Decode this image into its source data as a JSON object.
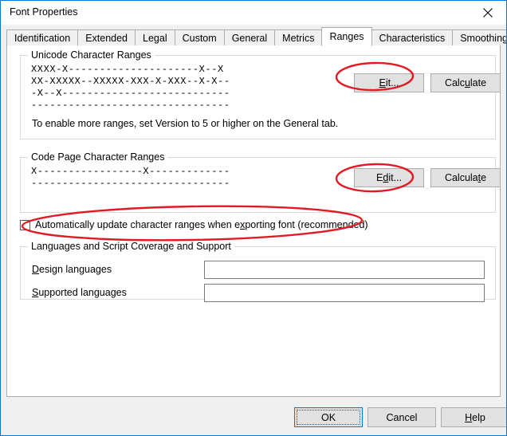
{
  "window": {
    "title": "Font Properties",
    "close_icon": "close-icon",
    "border_color": "#0078d7"
  },
  "tabs": [
    {
      "label": "Identification",
      "selected": false
    },
    {
      "label": "Extended",
      "selected": false
    },
    {
      "label": "Legal",
      "selected": false
    },
    {
      "label": "Custom",
      "selected": false
    },
    {
      "label": "General",
      "selected": false
    },
    {
      "label": "Metrics",
      "selected": false
    },
    {
      "label": "Ranges",
      "selected": true
    },
    {
      "label": "Characteristics",
      "selected": false
    },
    {
      "label": "Smoothing",
      "selected": false
    }
  ],
  "unicode_group": {
    "legend": "Unicode Character Ranges",
    "rows": [
      "XXXX-X---------------------X--X",
      "XX-XXXXX--XXXXX-XXX-X-XXX--X-X--",
      "-X--X---------------------------",
      "--------------------------------"
    ],
    "hint": "To enable more ranges, set Version to 5 or higher on the General tab.",
    "edit_button": {
      "pre": "E",
      "accel": "d",
      "post": "it...",
      "full": "Edit...",
      "accel_first": true
    },
    "calculate_button": {
      "pre": "Calc",
      "accel": "u",
      "post": "late",
      "full": "Calculate"
    }
  },
  "codepage_group": {
    "legend": "Code Page Character Ranges",
    "rows": [
      "X-----------------X-------------",
      "--------------------------------"
    ],
    "edit_button": {
      "pre": "E",
      "accel": "d",
      "post": "it...",
      "full": "Edit..."
    },
    "calculate_button": {
      "pre": "Calcula",
      "accel": "t",
      "post": "e",
      "full": "Calculate"
    }
  },
  "auto_update_checkbox": {
    "checked": false,
    "pre": "Automatically update character ranges when e",
    "accel": "x",
    "post": "porting font (recommended)",
    "full": "Automatically update character ranges when exporting font (recommended)"
  },
  "languages_group": {
    "legend": "Languages and Script Coverage and Support",
    "design": {
      "accel": "D",
      "rest": "esign languages",
      "full": "Design languages",
      "value": "",
      "placeholder": ""
    },
    "supported": {
      "accel": "S",
      "rest": "upported languages",
      "full": "Supported languages",
      "value": "",
      "placeholder": ""
    }
  },
  "footer": {
    "ok": "OK",
    "cancel": "Cancel",
    "help": {
      "accel": "H",
      "rest": "elp",
      "full": "Help"
    }
  },
  "annotations": {
    "color": "#e01b24",
    "shapes": [
      {
        "name": "ellipse-around-unicode-edit-button"
      },
      {
        "name": "ellipse-around-codepage-edit-button"
      },
      {
        "name": "ellipse-around-auto-update-checkbox"
      }
    ]
  }
}
